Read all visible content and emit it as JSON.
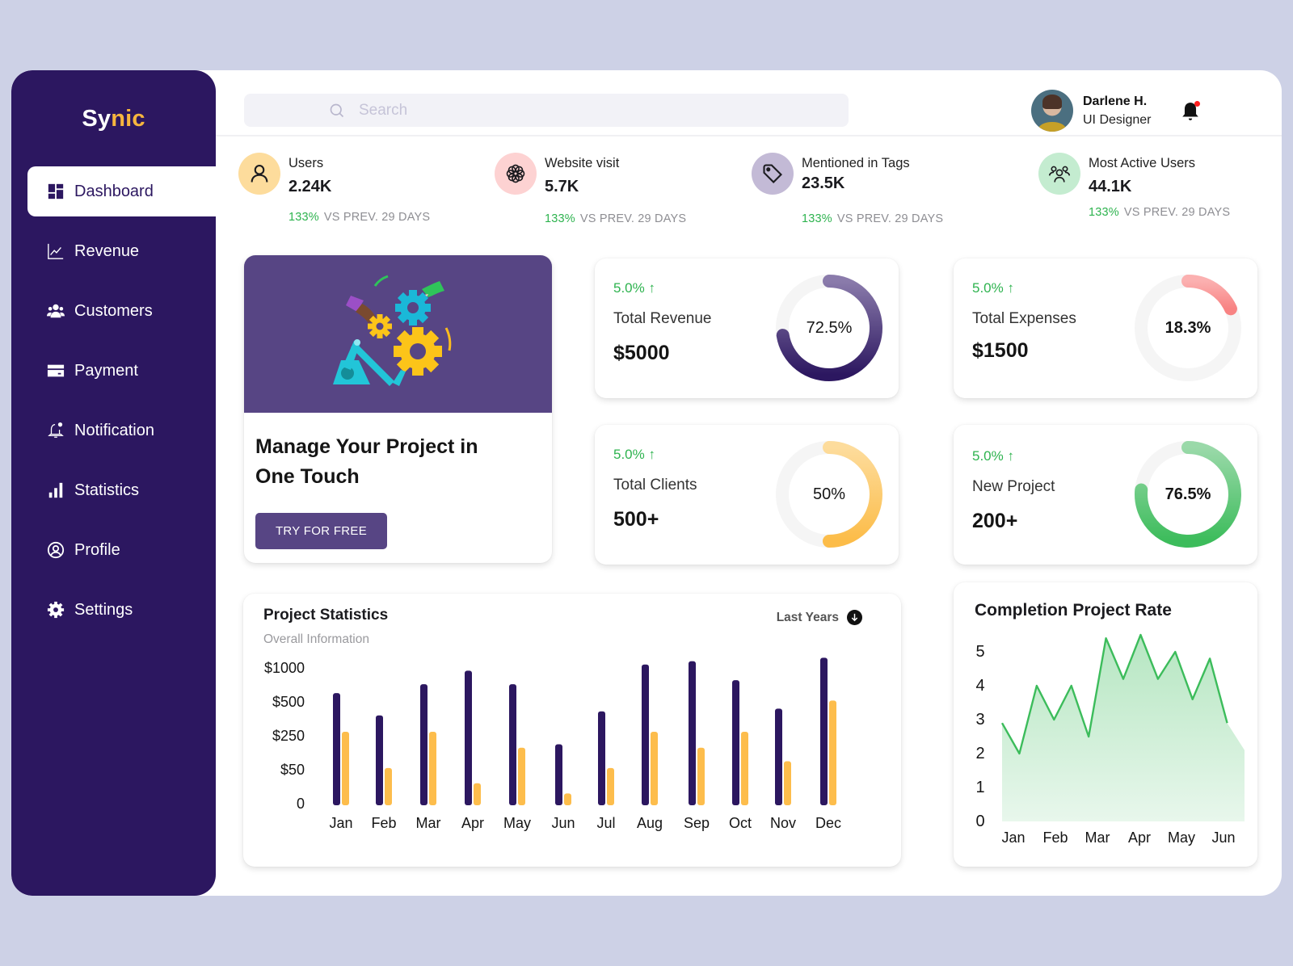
{
  "app": {
    "logo_main": "Sy",
    "logo_accent": "nic"
  },
  "sidebar": {
    "items": [
      {
        "label": "Dashboard",
        "icon": "dashboard-icon",
        "active": true
      },
      {
        "label": "Revenue",
        "icon": "trend-line-icon"
      },
      {
        "label": "Customers",
        "icon": "users-icon"
      },
      {
        "label": "Payment",
        "icon": "credit-card-icon"
      },
      {
        "label": "Notification",
        "icon": "bell-icon"
      },
      {
        "label": "Statistics",
        "icon": "bar-chart-icon"
      },
      {
        "label": "Profile",
        "icon": "user-circle-icon"
      },
      {
        "label": "Settings",
        "icon": "gear-icon"
      }
    ]
  },
  "header": {
    "search": {
      "placeholder": "Search",
      "value": ""
    },
    "user": {
      "name": "Darlene H.",
      "role": "UI Designer"
    },
    "notifications": {
      "has_unread": true
    }
  },
  "stats": [
    {
      "label": "Users",
      "value": "2.24K",
      "change": "133%",
      "compare": "VS PREV. 29 DAYS",
      "icon": "user-icon",
      "color": "#fddc9c"
    },
    {
      "label": "Website visit",
      "value": "5.7K",
      "change": "133%",
      "compare": "VS PREV. 29 DAYS",
      "icon": "flower-icon",
      "color": "#fdd2d2"
    },
    {
      "label": "Mentioned in Tags",
      "value": "23.5K",
      "change": "133%",
      "compare": "VS PREV. 29 DAYS",
      "icon": "tag-icon",
      "color": "#c3bad6"
    },
    {
      "label": "Most Active Users",
      "value": "44.1K",
      "change": "133%",
      "compare": "VS PREV. 29 DAYS",
      "icon": "group-icon",
      "color": "#c4ecd0"
    }
  ],
  "promo": {
    "title": "Manage Your Project in One Touch",
    "button": "TRY FOR FREE"
  },
  "kpis": [
    {
      "trend": "5.0% ↑",
      "label": "Total Revenue",
      "value": "$5000",
      "percent_label": "72.5%",
      "percent": 72.5,
      "color_start": "#8a7bab",
      "color_end": "#2c1760"
    },
    {
      "trend": "5.0% ↑",
      "label": "Total Expenses",
      "value": "$1500",
      "percent_label": "18.3%",
      "percent": 18.3,
      "color_start": "#fbb0b0",
      "color_end": "#f88383"
    },
    {
      "trend": "5.0% ↑",
      "label": "Total Clients",
      "value": "500+",
      "percent_label": "50%",
      "percent": 50,
      "color_start": "#fddc9c",
      "color_end": "#fcbc48"
    },
    {
      "trend": "5.0% ↑",
      "label": "New Project",
      "value": "200+",
      "percent_label": "76.5%",
      "percent": 76.5,
      "color_start": "#9ad9a9",
      "color_end": "#3cbc5b"
    }
  ],
  "project_statistics": {
    "title": "Project Statistics",
    "subtitle": "Overall Information",
    "filter": "Last Years"
  },
  "completion_rate": {
    "title": "Completion Project Rate"
  },
  "chart_data": [
    {
      "type": "bar",
      "title": "Project Statistics",
      "subtitle": "Overall Information",
      "categories": [
        "Jan",
        "Feb",
        "Mar",
        "Apr",
        "May",
        "Jun",
        "Jul",
        "Aug",
        "Sep",
        "Oct",
        "Nov",
        "Dec"
      ],
      "y_ticks": [
        "0",
        "$50",
        "$250",
        "$500",
        "$1000"
      ],
      "y_tick_values": [
        0,
        50,
        250,
        500,
        1000
      ],
      "y_scale": "piecewise (equal spacing per tick)",
      "series": [
        {
          "name": "Series 1",
          "color": "#2c1760",
          "values": [
            630,
            400,
            760,
            960,
            760,
            200,
            430,
            1050,
            1100,
            820,
            450,
            1150
          ]
        },
        {
          "name": "Series 2",
          "color": "#fdbd4c",
          "values": [
            280,
            60,
            280,
            30,
            180,
            15,
            60,
            280,
            180,
            280,
            100,
            520
          ]
        }
      ],
      "grid": false,
      "legend": "none"
    },
    {
      "type": "area",
      "title": "Completion Project Rate",
      "categories": [
        "Jan",
        "Feb",
        "Mar",
        "Apr",
        "May",
        "Jun"
      ],
      "ylim": [
        0,
        5
      ],
      "y_ticks": [
        "0",
        "1",
        "2",
        "3",
        "4",
        "5"
      ],
      "values": [
        2.9,
        2.0,
        4.0,
        3.0,
        4.0,
        2.5,
        5.4,
        4.2,
        5.5,
        4.2,
        5.0,
        3.6,
        4.8,
        2.9,
        2.1
      ],
      "color": "#3cbc5b",
      "grid": false,
      "legend": "none"
    }
  ]
}
